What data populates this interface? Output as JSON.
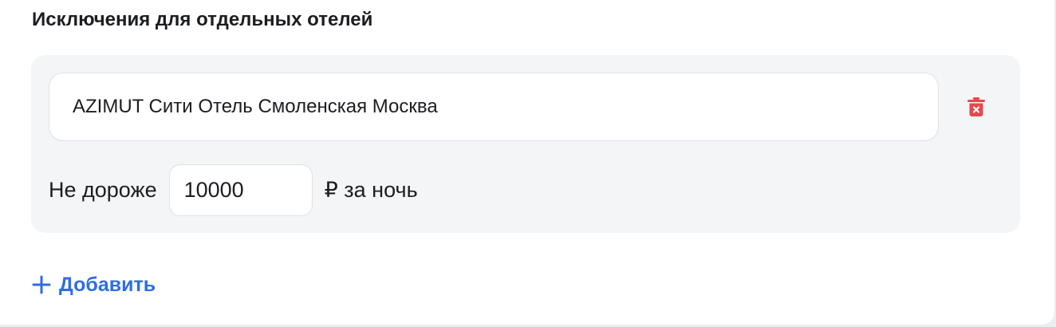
{
  "section": {
    "title": "Исключения для отдельных отелей"
  },
  "exceptions": [
    {
      "hotel_name": "AZIMUT Сити Отель Смоленская Москва",
      "price_label": "Не дороже",
      "price_value": "10000",
      "price_suffix": "₽ за ночь",
      "delete_icon": "trash-icon"
    }
  ],
  "actions": {
    "add_label": "Добавить",
    "add_icon": "plus-icon"
  },
  "colors": {
    "accent": "#2f6de1",
    "danger": "#e5484d",
    "panel_background": "#f4f5f7"
  }
}
